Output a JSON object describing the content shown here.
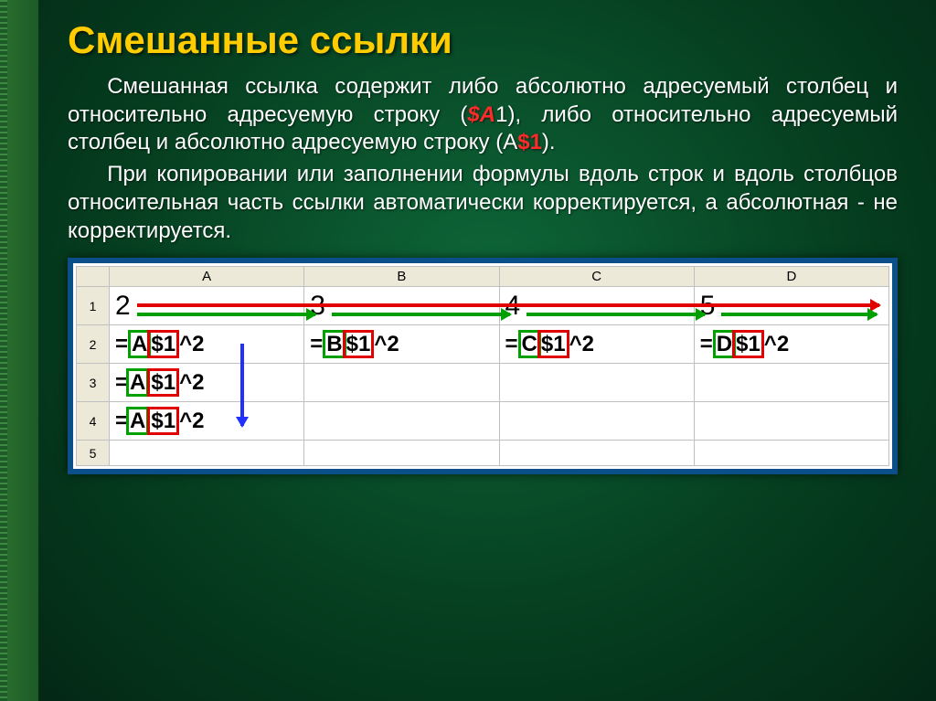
{
  "title": "Смешанные ссылки",
  "para1": {
    "p1": "Смешанная ссылка содержит либо абсолютно адресуемый столбец и относительно адресуемую строку (",
    "ref1": "$A",
    "ref1tail": "1",
    "p2": "), либо относительно адресуемый столбец и абсолютно адресуемую строку (",
    "ref2a": "A",
    "ref2b": "$1",
    "p3": ")."
  },
  "para2": "При копировании или заполнении формулы вдоль строк и вдоль столбцов относительная часть ссылки автоматически корректируется, а абсолютная - не корректируется.",
  "sheet": {
    "cols": [
      "A",
      "B",
      "C",
      "D"
    ],
    "rows": [
      "1",
      "2",
      "3",
      "4",
      "5"
    ],
    "row1": [
      "2",
      "3",
      "4",
      "5"
    ],
    "formulas": {
      "a2": {
        "col": "A",
        "abs": "$1",
        "suffix": "^2"
      },
      "b2": {
        "col": "B",
        "abs": "$1",
        "suffix": "^2"
      },
      "c2": {
        "col": "C",
        "abs": "$1",
        "suffix": "^2"
      },
      "d2": {
        "col": "D",
        "abs": "$1",
        "suffix": "^2"
      },
      "a3": {
        "col": "A",
        "abs": "$1",
        "suffix": "^2"
      },
      "a4": {
        "col": "A",
        "abs": "$1",
        "suffix": "^2"
      }
    },
    "eq": "="
  }
}
